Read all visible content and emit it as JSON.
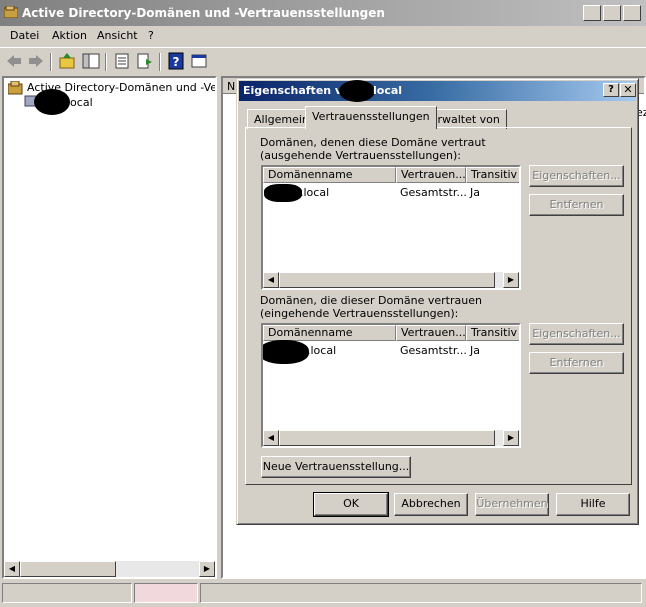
{
  "window": {
    "title": "Active Directory-Domänen und -Vertrauensstellungen"
  },
  "menu": [
    "Datei",
    "Aktion",
    "Ansicht",
    "?"
  ],
  "tree": {
    "root_label": "Active Directory-Domänen und -Vertrauensstellungen",
    "child_label": "local"
  },
  "right_pane": {
    "header_fragment": "N",
    "side_fragment": "ez"
  },
  "dialog": {
    "title_prefix": "Eigenschaften vo",
    "title_suffix": "local",
    "help_button": "?",
    "tabs": [
      "Allgemein",
      "Vertrauensstellungen",
      "Verwaltet von"
    ],
    "active_tab": "Vertrauensstellungen",
    "outgoing": {
      "label": "Domänen, denen diese Domäne vertraut (ausgehende Vertrauensstellungen):",
      "columns": [
        "Domänenname",
        "Vertrauen...",
        "Transitiv"
      ],
      "rows": [
        {
          "domain": ".local",
          "trust": "Gesamtstr...",
          "transitive": "Ja"
        }
      ],
      "properties_button": "Eigenschaften...",
      "remove_button": "Entfernen"
    },
    "incoming": {
      "label": "Domänen, die dieser Domäne vertrauen (eingehende Vertrauensstellungen):",
      "columns": [
        "Domänenname",
        "Vertrauen...",
        "Transitiv"
      ],
      "rows": [
        {
          "domain": ".local",
          "trust": "Gesamtstr...",
          "transitive": "Ja"
        }
      ],
      "properties_button": "Eigenschaften...",
      "remove_button": "Entfernen"
    },
    "new_trust_button": "Neue Vertrauensstellung...",
    "buttons": {
      "ok": "OK",
      "cancel": "Abbrechen",
      "apply": "Übernehmen",
      "help": "Hilfe"
    }
  }
}
